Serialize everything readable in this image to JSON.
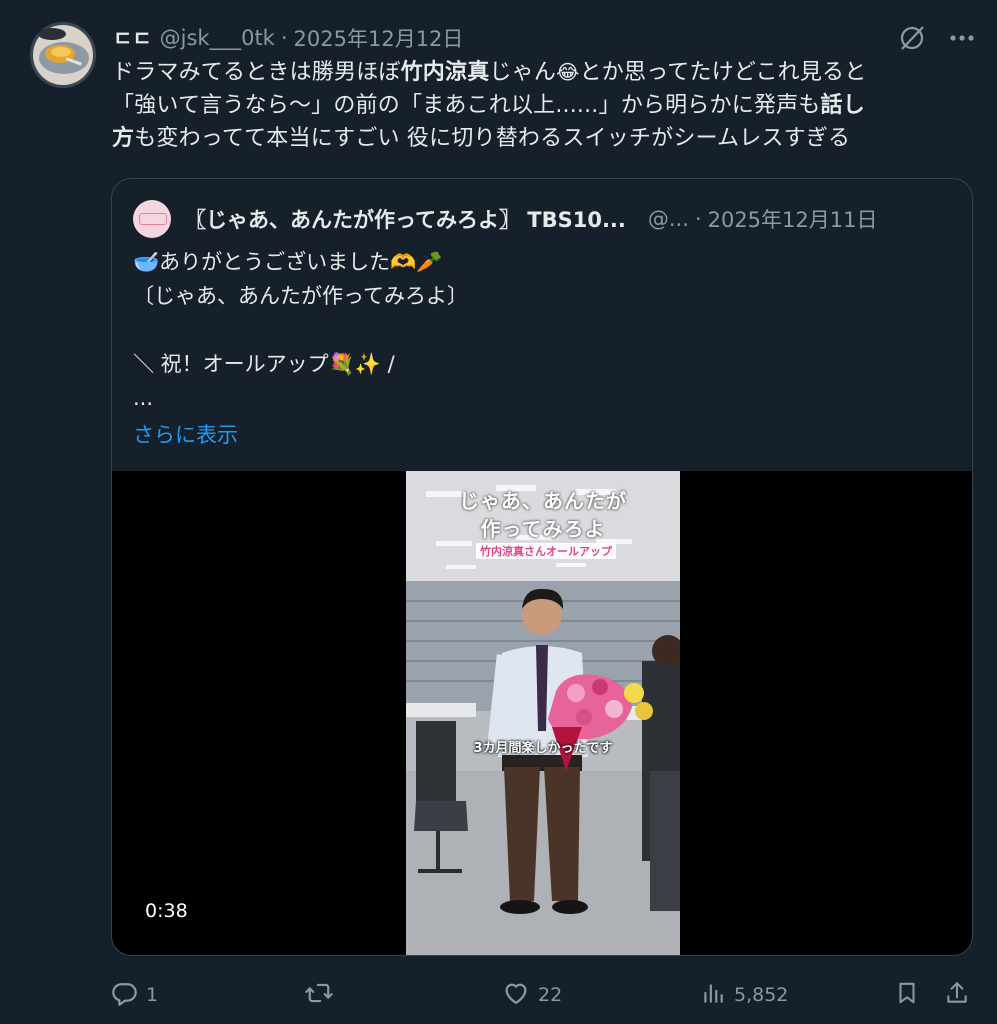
{
  "tweet": {
    "author": {
      "display_name": "ㄷㄷ",
      "handle": "@jsk___0tk",
      "separator": "·",
      "date": "2025年12月12日"
    },
    "text": {
      "p1": "ドラマみてるときは勝男ほぼ",
      "b1": "竹内涼真",
      "p2": "じゃん",
      "emoji1": "😂",
      "p3": "とか思ってたけどこれ見ると",
      "p4": "「強いて言うなら〜」の前の「まあこれ以上......」から明らかに発声も",
      "b2": "話し",
      "b3": "方",
      "p5": "も変わってて本当にすごい 役に切り替わるスイッチがシームレスすぎる"
    },
    "header_icons": {
      "grok": "grok-icon",
      "more": "more-icon"
    }
  },
  "quote": {
    "author": {
      "display_name": "〖じゃあ、あんたが作ってみろよ〗 TBS10...",
      "handle": "@...",
      "separator": "·",
      "date": "2025年12月11日"
    },
    "lines": [
      "🥣ありがとうございました🫶🥕",
      "〔じゃあ、あんたが作ってみろよ〕",
      "",
      "＼ 祝！オールアップ💐✨ /",
      "..."
    ],
    "show_more": "さらに表示",
    "video": {
      "duration": "0:38",
      "title_line1": "じゃあ、あんたが",
      "title_line2": "作ってみろよ",
      "subtitle_tag": "竹内涼真さんオールアップ",
      "caption": "3カ月間楽しかったです"
    }
  },
  "actions": {
    "reply": {
      "icon": "reply-icon",
      "count": "1"
    },
    "repost": {
      "icon": "repost-icon",
      "count": ""
    },
    "like": {
      "icon": "like-icon",
      "count": "22"
    },
    "views": {
      "icon": "views-icon",
      "count": "5,852"
    },
    "bookmark": {
      "icon": "bookmark-icon"
    },
    "share": {
      "icon": "share-icon"
    }
  },
  "colors": {
    "background": "#15202b",
    "text": "#e7e9ea",
    "secondary": "#8b98a5",
    "link": "#1d9bf0",
    "border": "#38444d"
  }
}
